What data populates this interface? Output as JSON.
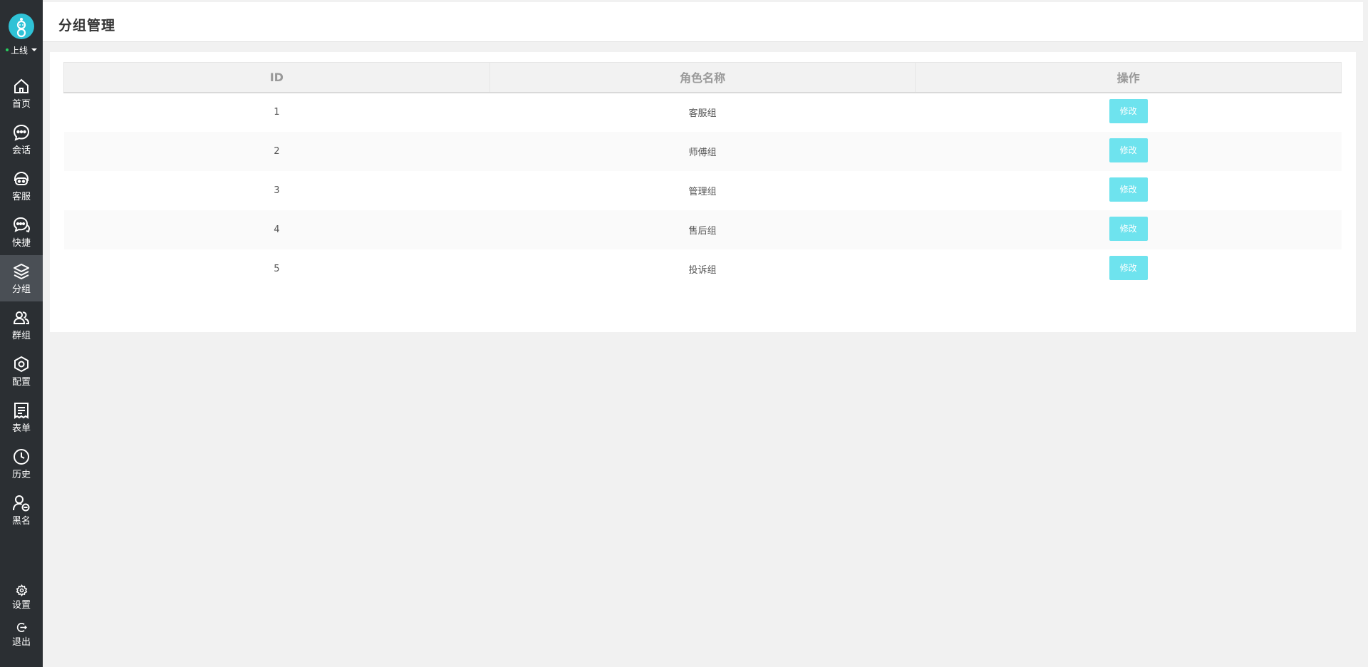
{
  "sidebar": {
    "status": "上线",
    "items": [
      {
        "label": "首页",
        "icon": "home-icon"
      },
      {
        "label": "会话",
        "icon": "chat-icon"
      },
      {
        "label": "客服",
        "icon": "agent-icon"
      },
      {
        "label": "快捷",
        "icon": "quick-reply-icon"
      },
      {
        "label": "分组",
        "icon": "layers-icon"
      },
      {
        "label": "群组",
        "icon": "group-icon"
      },
      {
        "label": "配置",
        "icon": "hexagon-settings-icon"
      },
      {
        "label": "表单",
        "icon": "form-icon"
      },
      {
        "label": "历史",
        "icon": "clock-icon"
      },
      {
        "label": "黑名",
        "icon": "blacklist-icon"
      }
    ],
    "bottom": [
      {
        "label": "设置",
        "icon": "gear-icon"
      },
      {
        "label": "退出",
        "icon": "logout-icon"
      }
    ]
  },
  "header": {
    "title": "分组管理"
  },
  "table": {
    "columns": [
      "ID",
      "角色名称",
      "操作"
    ],
    "rows": [
      {
        "id": "1",
        "name": "客服组",
        "action": "修改"
      },
      {
        "id": "2",
        "name": "师傅组",
        "action": "修改"
      },
      {
        "id": "3",
        "name": "管理组",
        "action": "修改"
      },
      {
        "id": "4",
        "name": "售后组",
        "action": "修改"
      },
      {
        "id": "5",
        "name": "投诉组",
        "action": "修改"
      }
    ]
  },
  "colors": {
    "sidebar": "#2b2f33",
    "active": "#4a4f55",
    "accent": "#6ee3ee",
    "logo": "#2fc2d6",
    "online": "#27d05f"
  }
}
